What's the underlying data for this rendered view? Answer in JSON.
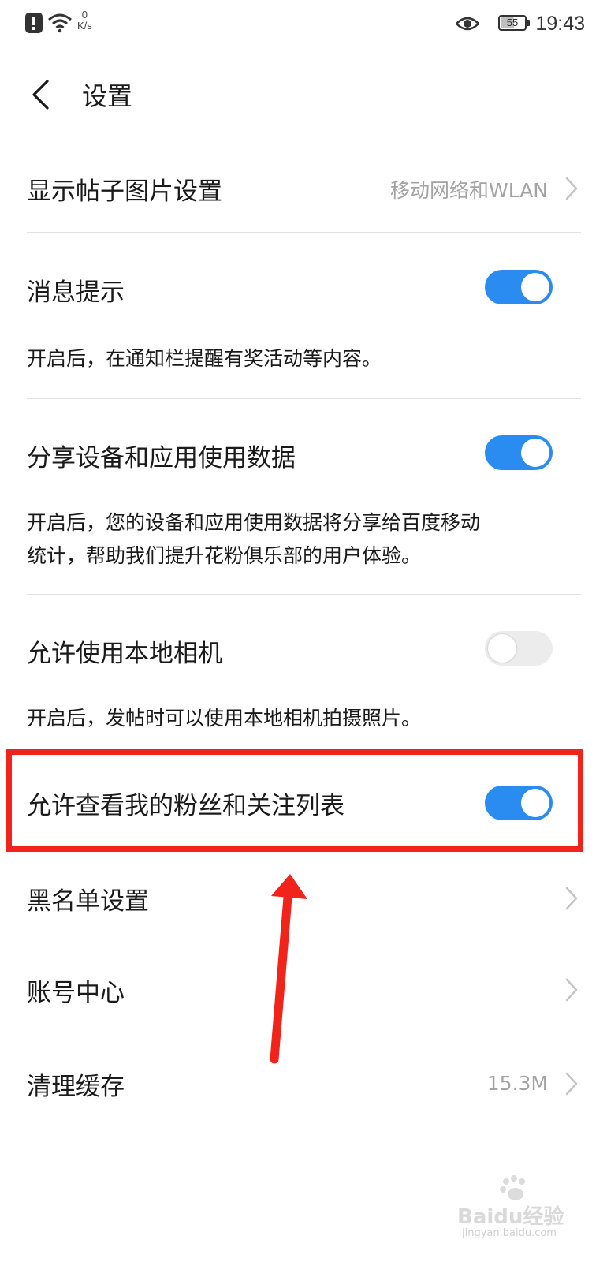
{
  "status_bar": {
    "speed_value": "0",
    "speed_unit": "K/s",
    "battery": "55",
    "time": "19:43"
  },
  "header": {
    "title": "设置"
  },
  "settings": {
    "image_display": {
      "label": "显示帖子图片设置",
      "value": "移动网络和WLAN"
    },
    "message_tip": {
      "label": "消息提示",
      "enabled": true,
      "description": "开启后，在通知栏提醒有奖活动等内容。"
    },
    "share_data": {
      "label": "分享设备和应用使用数据",
      "enabled": true,
      "description_line1": "开启后，您的设备和应用使用数据将分享给百度移动",
      "description_line2": "统计，帮助我们提升花粉俱乐部的用户体验。"
    },
    "local_camera": {
      "label": "允许使用本地相机",
      "enabled": false,
      "description": "开启后，发帖时可以使用本地相机拍摄照片。"
    },
    "fans_list": {
      "label": "允许查看我的粉丝和关注列表",
      "enabled": true
    },
    "blacklist": {
      "label": "黑名单设置"
    },
    "account_center": {
      "label": "账号中心"
    },
    "clear_cache": {
      "label": "清理缓存",
      "value": "15.3M"
    }
  },
  "colors": {
    "toggle_on": "#2a8cf0",
    "toggle_off": "#ececec",
    "annotation_red": "#f0241a",
    "secondary_text": "#a3a3a3"
  },
  "icons": [
    "notification-alert-icon",
    "wifi-icon",
    "eye-icon",
    "battery-icon",
    "back-arrow-icon",
    "chevron-right-icon"
  ],
  "watermark": {
    "logo_text": "Baidu经验",
    "url": "jingyan.baidu.com"
  }
}
